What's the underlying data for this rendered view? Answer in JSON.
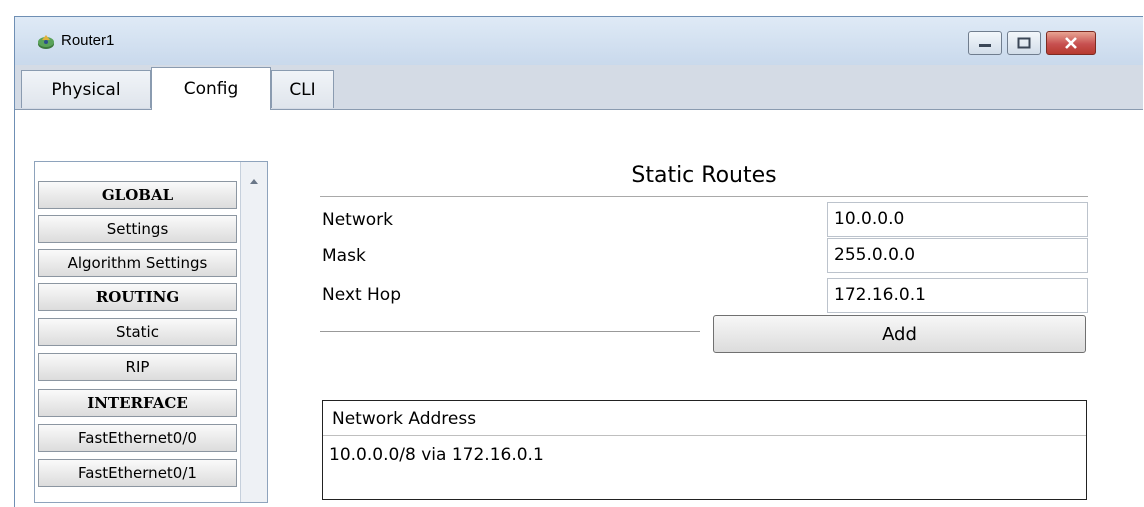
{
  "window": {
    "title": "Router1"
  },
  "icons": {
    "app": "router-icon",
    "minimize": "minimize-icon",
    "maximize": "maximize-icon",
    "close": "close-icon",
    "scroll_up": "chevron-up-icon"
  },
  "tabs": [
    {
      "label": "Physical",
      "active": false
    },
    {
      "label": "Config",
      "active": true
    },
    {
      "label": "CLI",
      "active": false
    }
  ],
  "sidebar": {
    "items": [
      {
        "label": "GLOBAL",
        "type": "header"
      },
      {
        "label": "Settings",
        "type": "item"
      },
      {
        "label": "Algorithm Settings",
        "type": "item"
      },
      {
        "label": "ROUTING",
        "type": "header"
      },
      {
        "label": "Static",
        "type": "item"
      },
      {
        "label": "RIP",
        "type": "item"
      },
      {
        "label": "INTERFACE",
        "type": "header"
      },
      {
        "label": "FastEthernet0/0",
        "type": "item"
      },
      {
        "label": "FastEthernet0/1",
        "type": "item"
      }
    ]
  },
  "panel": {
    "title": "Static Routes",
    "fields": [
      {
        "label": "Network",
        "value": "10.0.0.0"
      },
      {
        "label": "Mask",
        "value": "255.0.0.0"
      },
      {
        "label": "Next Hop",
        "value": "172.16.0.1"
      }
    ],
    "add_label": "Add",
    "table": {
      "header": "Network Address",
      "rows": [
        "10.0.0.0/8 via 172.16.0.1"
      ]
    }
  },
  "colors": {
    "close_button": "#c75050",
    "title_bar": "#dfeaf6",
    "tab_strip": "#d4dbe5"
  }
}
